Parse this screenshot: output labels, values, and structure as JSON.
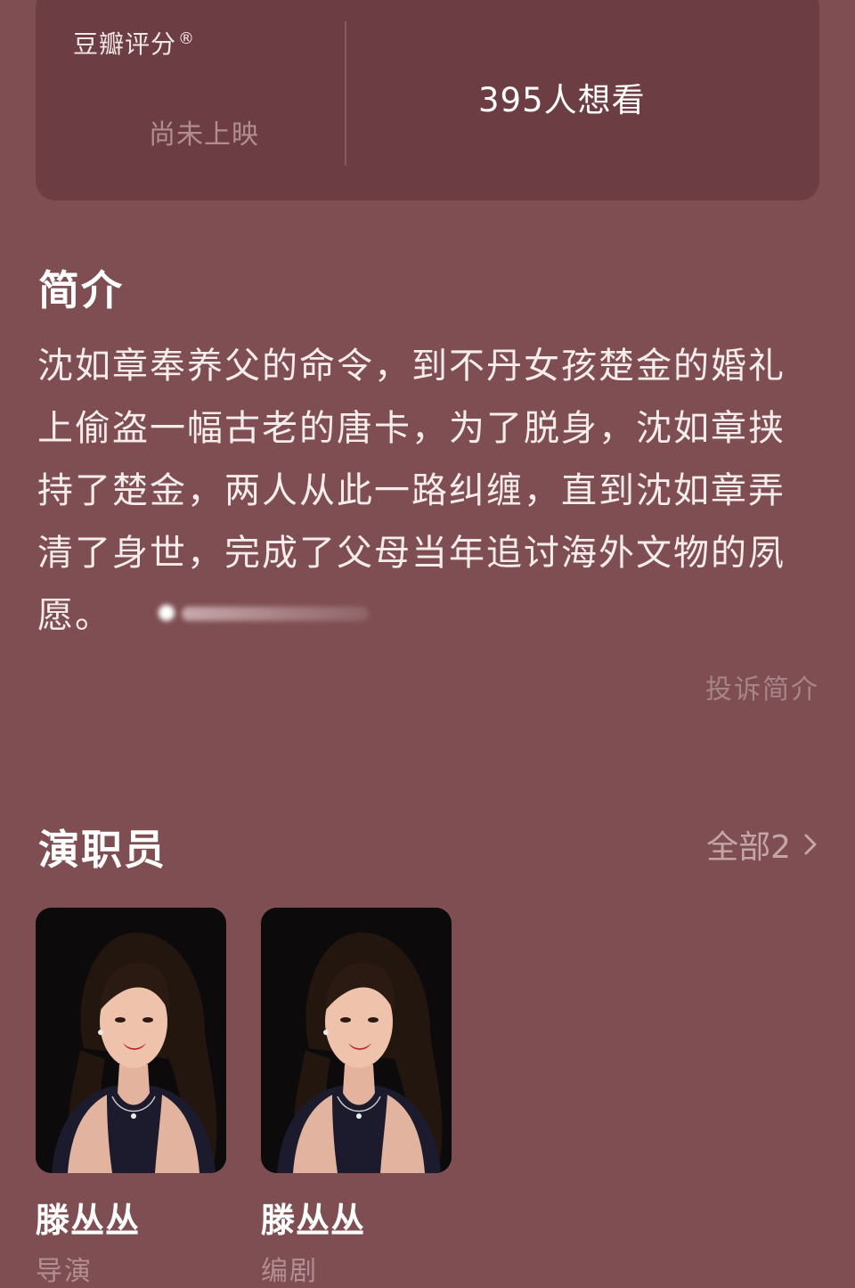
{
  "rating": {
    "label": "豆瓣评分",
    "label_mark": "®",
    "status": "尚未上映",
    "want_to_watch": "395人想看"
  },
  "intro": {
    "title": "简介",
    "text": "沈如章奉养父的命令，到不丹女孩楚金的婚礼上偷盗一幅古老的唐卡，为了脱身，沈如章挟持了楚金，两人从此一路纠缠，直到沈如章弄清了身世，完成了父母当年追讨海外文物的夙愿。",
    "report_label": "投诉简介"
  },
  "cast": {
    "title": "演职员",
    "all_label": "全部2",
    "all_icon": "chevron-right-icon",
    "members": [
      {
        "name": "滕丛丛",
        "role": "导演"
      },
      {
        "name": "滕丛丛",
        "role": "编剧"
      }
    ]
  },
  "colors": {
    "background": "#7e4e52",
    "card": "#6c3e43",
    "muted_text": "#b08e91"
  }
}
